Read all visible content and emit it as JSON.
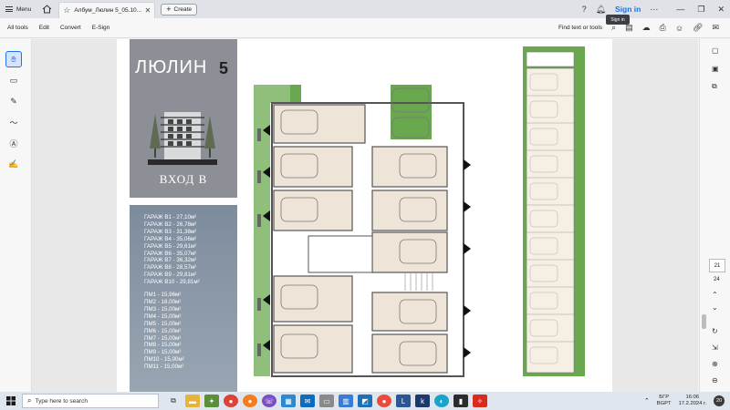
{
  "titlebar": {
    "menu_label": "Menu",
    "tab_title": "Албум_Люлин 5_05.10....",
    "create_label": "Create",
    "signin_label": "Sign in"
  },
  "tooltip": "Sign in",
  "toolbar": {
    "all_tools": "All tools",
    "edit": "Edit",
    "convert": "Convert",
    "esign": "E-Sign",
    "find": "Find text or tools"
  },
  "brochure": {
    "brand_name": "ЛЮЛИН",
    "brand_number": "5",
    "entrance": "ВХОД В",
    "garages": [
      "ГАРАЖ В1 - 27,10м²",
      "ГАРАЖ В2 - 26,78м²",
      "ГАРАЖ В3 - 31,38м²",
      "ГАРАЖ В4 - 35,06м²",
      "ГАРАЖ В5 - 29,61м²",
      "ГАРАЖ В6 - 35,07м²",
      "ГАРАЖ В7 - 36,32м²",
      "ГАРАЖ В8 - 28,57м²",
      "ГАРАЖ В9 - 29,81м²",
      "ГАРАЖ В10 - 29,81м²"
    ],
    "parking": [
      "ПМ1 - 15,96м²",
      "ПМ2 - 18,00м²",
      "ПМ3 - 15,00м²",
      "ПМ4 - 15,00м²",
      "ПМ5 - 15,00м²",
      "ПМ6 - 15,00м²",
      "ПМ7 - 15,00м²",
      "ПМ8 - 15,00м²",
      "ПМ9 - 15,00м²",
      "ПМ10 - 15,00м²",
      "ПМ11 - 15,00м²"
    ]
  },
  "pager": {
    "current_page": "21",
    "total_pages": "24"
  },
  "taskbar": {
    "search_placeholder": "Type here to search",
    "lang_top": "БГР",
    "lang_bottom": "BGPT",
    "time": "16:06",
    "date": "17.2.2024 г.",
    "notifications": "20"
  }
}
